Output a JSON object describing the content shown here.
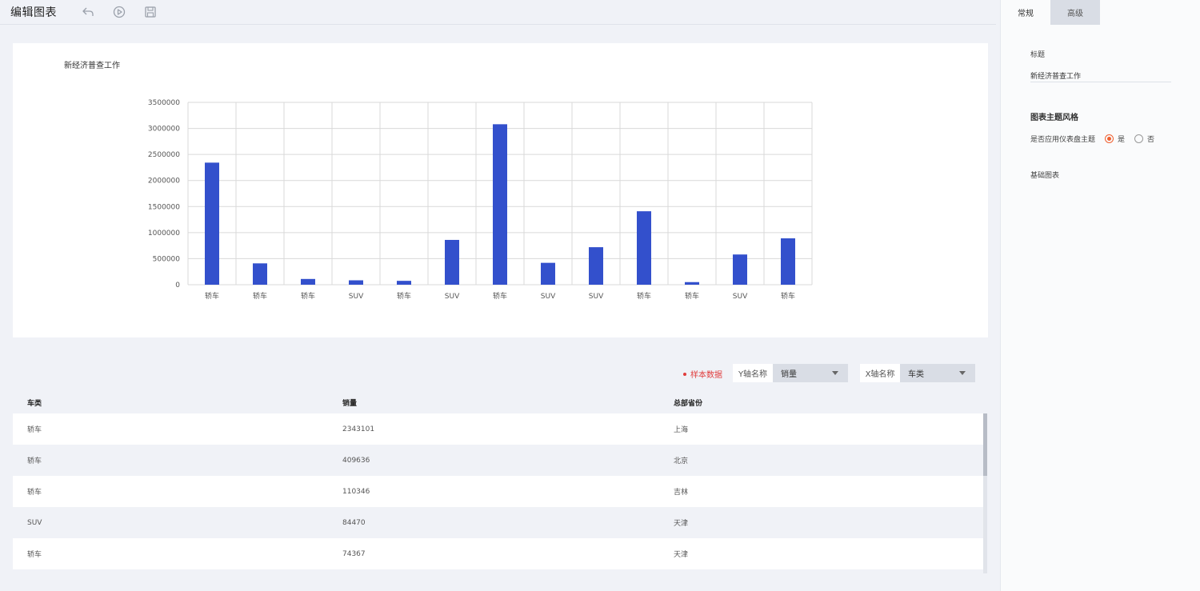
{
  "header": {
    "title": "编辑图表",
    "undo_icon": "undo-icon",
    "preview_icon": "play-circle-icon",
    "save_icon": "save-icon"
  },
  "chart_data": {
    "type": "bar",
    "title": "新经济普查工作",
    "categories": [
      "轿车",
      "轿车",
      "轿车",
      "SUV",
      "轿车",
      "SUV",
      "轿车",
      "SUV",
      "SUV",
      "轿车",
      "轿车",
      "SUV",
      "轿车"
    ],
    "values": [
      2343101,
      409636,
      110346,
      84470,
      74367,
      860000,
      3080000,
      420000,
      720000,
      1410000,
      50000,
      580000,
      890000
    ],
    "yticks": [
      "0",
      "500000",
      "1000000",
      "1500000",
      "2000000",
      "2500000",
      "3000000",
      "3500000"
    ],
    "ylim": [
      0,
      3500000
    ],
    "grid": true,
    "bar_color": "#3350cc"
  },
  "controls": {
    "sample_label": "样本数据",
    "y_axis": {
      "label": "Y轴名称",
      "value": "销量"
    },
    "x_axis": {
      "label": "X轴名称",
      "value": "车类"
    }
  },
  "table": {
    "headers": [
      "车类",
      "销量",
      "总部省份"
    ],
    "rows": [
      [
        "轿车",
        "2343101",
        "上海"
      ],
      [
        "轿车",
        "409636",
        "北京"
      ],
      [
        "轿车",
        "110346",
        "吉林"
      ],
      [
        "SUV",
        "84470",
        "天津"
      ],
      [
        "轿车",
        "74367",
        "天津"
      ]
    ]
  },
  "panel": {
    "tabs": [
      "常规",
      "高级"
    ],
    "title_label": "标题",
    "title_value": "新经济普查工作",
    "theme_section": "图表主题风格",
    "theme_question": "是否应用仪表盘主题",
    "yes": "是",
    "no": "否",
    "base_chart": "基础图表",
    "accent_color": "#f06030"
  }
}
